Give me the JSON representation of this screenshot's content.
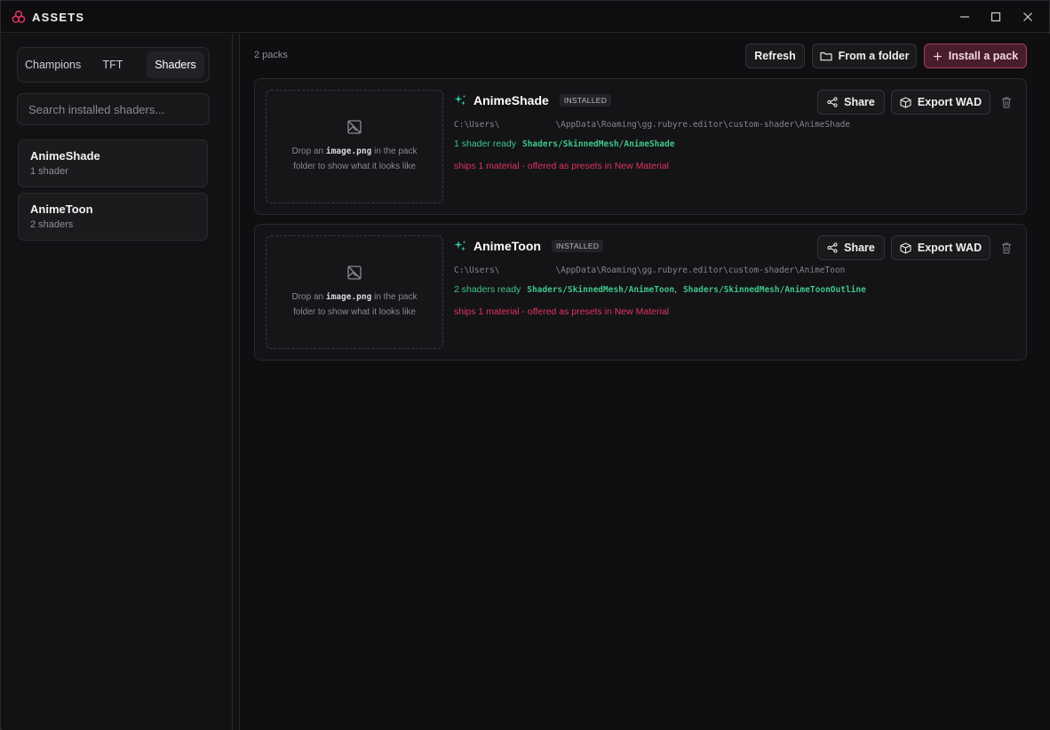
{
  "titlebar": {
    "title": "ASSETS",
    "logo_icon": "assets-logo-icon",
    "controls": [
      "minimize-icon",
      "maximize-icon",
      "close-icon"
    ]
  },
  "sidebar": {
    "tabs": [
      {
        "label": "Champions",
        "active": false
      },
      {
        "label": "TFT",
        "active": false
      },
      {
        "label": "Shaders",
        "active": true
      }
    ],
    "search": {
      "placeholder": "Search installed shaders...",
      "value": ""
    },
    "packs": [
      {
        "name": "AnimeShade",
        "sub": "1 shader"
      },
      {
        "name": "AnimeToon",
        "sub": "2 shaders"
      }
    ]
  },
  "main": {
    "pack_count": "2 packs",
    "toolbar": {
      "refresh": "Refresh",
      "from_folder": "From a folder",
      "install": "Install a pack"
    },
    "cards": [
      {
        "name": "AnimeShade",
        "badge": "INSTALLED",
        "path": "C:\\Users\\           \\AppData\\Roaming\\gg.rubyre.editor\\custom-shader\\AnimeShade",
        "ready": "1 shader ready",
        "shaders": [
          "Shaders/SkinnedMesh/AnimeShade"
        ],
        "ships": "ships 1 material - offered as presets in New Material",
        "dropzone": {
          "pre": "Drop an ",
          "code": "image.png",
          "post": " in the pack",
          "line2": "folder to show what it looks like"
        },
        "share": "Share",
        "export": "Export WAD"
      },
      {
        "name": "AnimeToon",
        "badge": "INSTALLED",
        "path": "C:\\Users\\           \\AppData\\Roaming\\gg.rubyre.editor\\custom-shader\\AnimeToon",
        "ready": "2 shaders ready",
        "shaders": [
          "Shaders/SkinnedMesh/AnimeToon",
          "Shaders/SkinnedMesh/AnimeToonOutline"
        ],
        "ships": "ships 1 material - offered as presets in New Material",
        "dropzone": {
          "pre": "Drop an ",
          "code": "image.png",
          "post": " in the pack",
          "line2": "folder to show what it looks like"
        },
        "share": "Share",
        "export": "Export WAD"
      }
    ],
    "sep": ","
  },
  "colors": {
    "accent": "#e0335f",
    "ready_green": "#3fc58a",
    "sparkle_teal": "#2ec4a0"
  }
}
